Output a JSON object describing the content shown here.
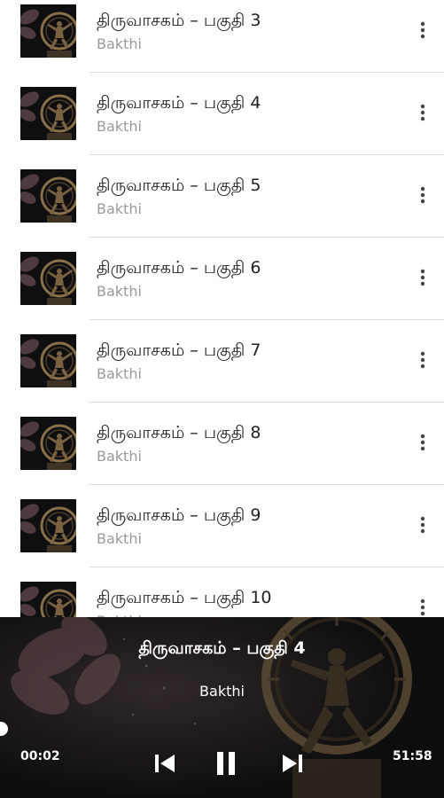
{
  "tracks": [
    {
      "title": "திருவாசகம் – பகுதி 3",
      "artist": "Bakthi"
    },
    {
      "title": "திருவாசகம் – பகுதி 4",
      "artist": "Bakthi"
    },
    {
      "title": "திருவாசகம் – பகுதி 5",
      "artist": "Bakthi"
    },
    {
      "title": "திருவாசகம் – பகுதி 6",
      "artist": "Bakthi"
    },
    {
      "title": "திருவாசகம் – பகுதி 7",
      "artist": "Bakthi"
    },
    {
      "title": "திருவாசகம் – பகுதி 8",
      "artist": "Bakthi"
    },
    {
      "title": "திருவாசகம் – பகுதி 9",
      "artist": "Bakthi"
    },
    {
      "title": "திருவாசகம் – பகுதி 10",
      "artist": "Bakthi"
    }
  ],
  "icons": {
    "more": "more-vertical-icon",
    "prev": "skip-previous-icon",
    "pause": "pause-icon",
    "next": "skip-next-icon",
    "thumb": "nataraja-artwork"
  },
  "player": {
    "title": "திருவாசகம் – பகுதி 4",
    "artist": "Bakthi",
    "current_time": "00:02",
    "total_time": "51:58",
    "progress": 0.0006,
    "state": "playing"
  },
  "colors": {
    "list_bg": "#ffffff",
    "title": "#222222",
    "artist": "#9a9a9a",
    "divider": "#dcdcdc",
    "player_bg": "#111111",
    "player_text": "#ffffff"
  }
}
